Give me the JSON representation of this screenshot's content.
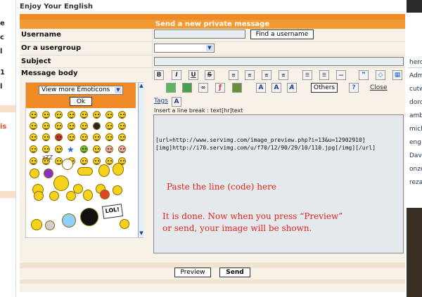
{
  "site": {
    "title": "Enjoy Your English"
  },
  "form": {
    "header": "Send a new private message",
    "username_label": "Username",
    "find_user_button": "Find a username",
    "usergroup_label": "Or a usergroup",
    "subject_label": "Subject",
    "body_label": "Message body"
  },
  "emoticons": {
    "select_label": "View more Emoticons",
    "ok_button": "Ok",
    "lol_sign": "LOL!"
  },
  "toolbar": {
    "others_button": "Others",
    "close_link": "Close",
    "tags_label": "Tags",
    "line_break_hint": "Insert a line break : text[hr]text"
  },
  "message": {
    "line1": "[url=http://www.servimg.com/image_preview.php?i=13&u=12902910]",
    "line2": "[img]http://i70.servimg.com/u/f70/12/90/29/10/110.jpg[/img][/url]"
  },
  "annotations": {
    "paste": "Paste the line (code)  here",
    "done1": "It is done. Now when you press “Preview”",
    "done2": "or send, your image will be shown."
  },
  "buttons": {
    "preview": "Preview",
    "send": "Send"
  },
  "left_sidebar": {
    "frag1": "e",
    "frag2": "is"
  },
  "right_sidebar": {
    "items": [
      "hero",
      "Adm",
      "cutw",
      "doro",
      "amb",
      "mich",
      "eng",
      "Dav",
      "onze",
      "reza"
    ]
  },
  "colors": {
    "accent": "#f29a33",
    "accent_dark": "#f08a24",
    "note": "#e0261a",
    "panel": "#f7f1e7"
  }
}
